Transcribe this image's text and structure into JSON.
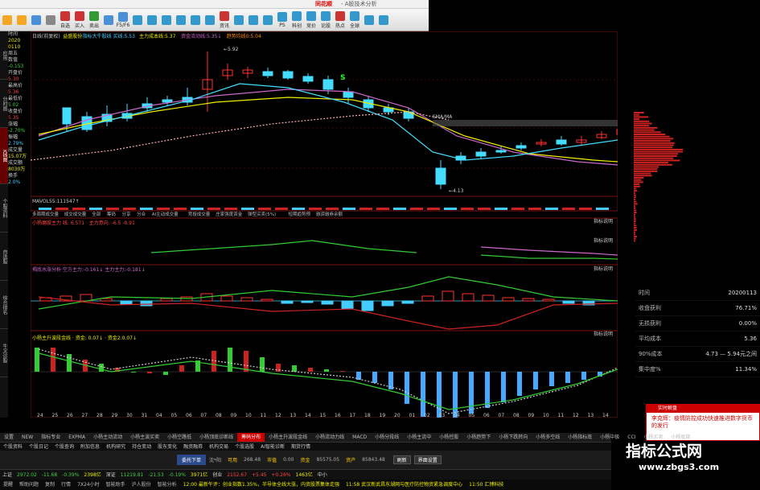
{
  "title": {
    "brand": "同花顺",
    "subtitle": "- A股技术分析"
  },
  "toolbar": [
    {
      "icon": "back-icon",
      "label": "",
      "color": "#f5a623"
    },
    {
      "icon": "forward-icon",
      "label": "",
      "color": "#f5a623"
    },
    {
      "icon": "home-icon",
      "label": "",
      "color": "#4a90d9"
    },
    {
      "icon": "pen-icon",
      "label": "",
      "color": "#888"
    },
    {
      "icon": "self-select-icon",
      "label": "自选",
      "color": "#c33"
    },
    {
      "icon": "buy-icon",
      "label": "买入",
      "color": "#c33"
    },
    {
      "icon": "sell-icon",
      "label": "卖出",
      "color": "#393"
    },
    {
      "icon": "screen-icon",
      "label": "",
      "color": "#4a90d9"
    },
    {
      "icon": "f10-icon",
      "label": "F5/F6",
      "color": "#4a90d9"
    },
    {
      "icon": "chart-icon",
      "label": "",
      "color": "#39c"
    },
    {
      "icon": "chart2-icon",
      "label": "",
      "color": "#39c"
    },
    {
      "icon": "list-icon",
      "label": "",
      "color": "#39c"
    },
    {
      "icon": "dot-icon",
      "label": "",
      "color": "#39c"
    },
    {
      "icon": "ai-icon",
      "label": "",
      "color": "#39c"
    },
    {
      "icon": "sort-icon",
      "label": "",
      "color": "#39c"
    },
    {
      "icon": "info-icon",
      "label": "资讯",
      "color": "#c33"
    },
    {
      "icon": "quant-icon",
      "label": "",
      "color": "#39c"
    },
    {
      "icon": "report-icon",
      "label": "",
      "color": "#39c"
    },
    {
      "icon": "list2-icon",
      "label": "",
      "color": "#39c"
    },
    {
      "icon": "ps-icon",
      "label": "PS",
      "color": "#39c"
    },
    {
      "icon": "tech-icon",
      "label": "科创",
      "color": "#39c"
    },
    {
      "icon": "first-icon",
      "label": "竞价",
      "color": "#39c"
    },
    {
      "icon": "news-icon",
      "label": "论股",
      "color": "#39c"
    },
    {
      "icon": "hot-icon",
      "label": "热点",
      "color": "#c33"
    },
    {
      "icon": "globe-icon",
      "label": "全球",
      "color": "#39c"
    },
    {
      "icon": "more-icon",
      "label": "",
      "color": "#39c"
    },
    {
      "icon": "refresh-icon",
      "label": "",
      "color": "#39c"
    }
  ],
  "left_tabs": [
    "应用",
    "分时图",
    "K线图",
    "个股资料",
    "自选股",
    "综合排名",
    "牛叉诊股"
  ],
  "side_info": [
    {
      "t": "时间",
      "c": ""
    },
    {
      "t": "2020",
      "c": "y"
    },
    {
      "t": "0110",
      "c": "y"
    },
    {
      "t": "周五",
      "c": ""
    },
    {
      "t": "数值",
      "c": ""
    },
    {
      "t": "-0.153",
      "c": "g"
    },
    {
      "t": "开盘价",
      "c": ""
    },
    {
      "t": "5.30",
      "c": "r"
    },
    {
      "t": "最高价",
      "c": ""
    },
    {
      "t": "5.36",
      "c": "r"
    },
    {
      "t": "最低价",
      "c": ""
    },
    {
      "t": "5.02",
      "c": "g"
    },
    {
      "t": "收盘价",
      "c": ""
    },
    {
      "t": "5.35",
      "c": "r"
    },
    {
      "t": "涨幅",
      "c": ""
    },
    {
      "t": "-2.70%",
      "c": "g"
    },
    {
      "t": "振幅",
      "c": ""
    },
    {
      "t": "2.79%",
      "c": "c"
    },
    {
      "t": "成交量",
      "c": ""
    },
    {
      "t": "15.07万",
      "c": "y"
    },
    {
      "t": "成交额",
      "c": ""
    },
    {
      "t": "8030万",
      "c": "y"
    },
    {
      "t": "换手",
      "c": ""
    },
    {
      "t": "2.0%",
      "c": "c"
    }
  ],
  "main_legend": {
    "name": "日线(前复权)",
    "stock": "益盛股份",
    "ma1": "指标大牛股线 买线:5.53",
    "ma2": "主力成本线:5.37",
    "ma3": "资金流动线:5.35↓",
    "ma4": "趋势均线0:5.04"
  },
  "price_labels": {
    "high": "5.92",
    "low": "4.13",
    "ma_tag": "SMA/MA",
    "s_mark": "S",
    "right_top": "5.53",
    "right_bottom": "4.53"
  },
  "vol_legend": "MAVOL55:111547↑",
  "sub_tabs": [
    "多周期成交量",
    "成交成交量",
    "全部",
    "筹码",
    "分享",
    "分合",
    "AI主动成交量",
    "竞投成交量",
    "庄家强度资金",
    "弹型买卖(5%)",
    "短期趋势预",
    "融资融券余额"
  ],
  "macd_legend": "小杨磨股主力 线: 6.571 · 主力意向: -6.5 -0.91",
  "macd_right": [
    "-0.87",
    "5.00",
    "-0.76"
  ],
  "panel3_legend": "揭底水涨分析·空方主力:-0.161↓ 主力主力:-0.181↓",
  "panel3_right": [
    "0.148",
    "-0.461"
  ],
  "panel4_legend": "小杨主升波段金线 · 资金: 0.07↓ · 资金2:0.07↓",
  "panel4_right": [
    "0.326",
    "0.038",
    "0.063",
    "-0.132",
    "-0.337"
  ],
  "right_labels": [
    "指标说明",
    "指标说明",
    "指标说明",
    "指标说明"
  ],
  "x_axis": [
    "24",
    "25",
    "26",
    "27",
    "28",
    "29",
    "30",
    "31",
    "04",
    "05",
    "06",
    "07",
    "08",
    "09",
    "10",
    "11",
    "12",
    "13",
    "14",
    "15",
    "16",
    "17",
    "18",
    "19",
    "20",
    "01",
    "02",
    "03",
    "04",
    "05",
    "06",
    "07",
    "08",
    "09",
    "10",
    "11",
    "12",
    "13",
    "14"
  ],
  "info_table": [
    {
      "label": "时间",
      "value": "20200113"
    },
    {
      "label": "收盘获利",
      "value": "76.71%"
    },
    {
      "label": "无损获利",
      "value": "0.00%"
    },
    {
      "label": "平均成本",
      "value": "5.36"
    },
    {
      "label": "90%成本",
      "value": "4.73 — 5.94元之间"
    },
    {
      "label": "集中度%",
      "value": "11.34%"
    }
  ],
  "popup": {
    "header": "实时解盘",
    "body": "李克辉：疫情防控成功快速推进数字货币的发行"
  },
  "watermark": {
    "line1": "指标公式网",
    "line2": "www.zbgs3.com"
  },
  "bottom_tabs": [
    "设置",
    "NEW",
    "指标专业",
    "EXPMA",
    "小杨主动流动",
    "小杨主波买卖",
    "小杨空路低",
    "小杨顶底诊断线",
    "筹码分布",
    "小杨主升波段金线",
    "小杨流动力线",
    "MACD",
    "小杨分段线",
    "小杨主流中",
    "小杨控股",
    "小杨趋势下",
    "小杨下跌转向",
    "小杨多空线",
    "小杨指标底",
    "小杨中极",
    "CCI",
    "小杨买卖",
    "小杨底部"
  ],
  "bottom_active": 8,
  "status1": [
    "个股资料",
    "个股日记",
    "个股查询",
    "附加信息",
    "机构研究",
    "持仓变动",
    "股东变化",
    "融资融券",
    "机构交易",
    "个股选股",
    "AI智能诊断",
    "期货行情"
  ],
  "order": {
    "label": "委托下单",
    "items": [
      "沈*阳",
      "可用",
      "268.48",
      "市值",
      "0.00",
      "资金",
      "85575.05",
      "资产",
      "85843.48"
    ],
    "btn1": "刷新",
    "btn2": "界面设置"
  },
  "indices": [
    {
      "name": "上证",
      "val": "2972.02",
      "chg": "-11.68",
      "pct": "-0.39%",
      "amt": "2398亿",
      "c": "g"
    },
    {
      "name": "深证",
      "val": "11219.81",
      "chg": "-21.53",
      "pct": "-0.19%",
      "amt": "3971亿",
      "c": "g"
    },
    {
      "name": "创业",
      "val": "2152.67",
      "chg": "+5.45",
      "pct": "+0.26%",
      "amt": "1463亿",
      "c": "r"
    },
    {
      "name": "中小",
      "val": "",
      "chg": "",
      "pct": "",
      "amt": "",
      "c": "r"
    }
  ],
  "status3": [
    "提醒",
    "帮助问题",
    "复制",
    "行情",
    "7X24小时",
    "智能助手",
    "沪人股份",
    "智能分析",
    "12:00 最新午评：创业指数1.35%，半导体全线大涨，内资股票集体走强",
    "11:58 武汉新武昌东湖网与医疗防控物资紧急调度中心",
    "11:50 汇博科技"
  ]
}
